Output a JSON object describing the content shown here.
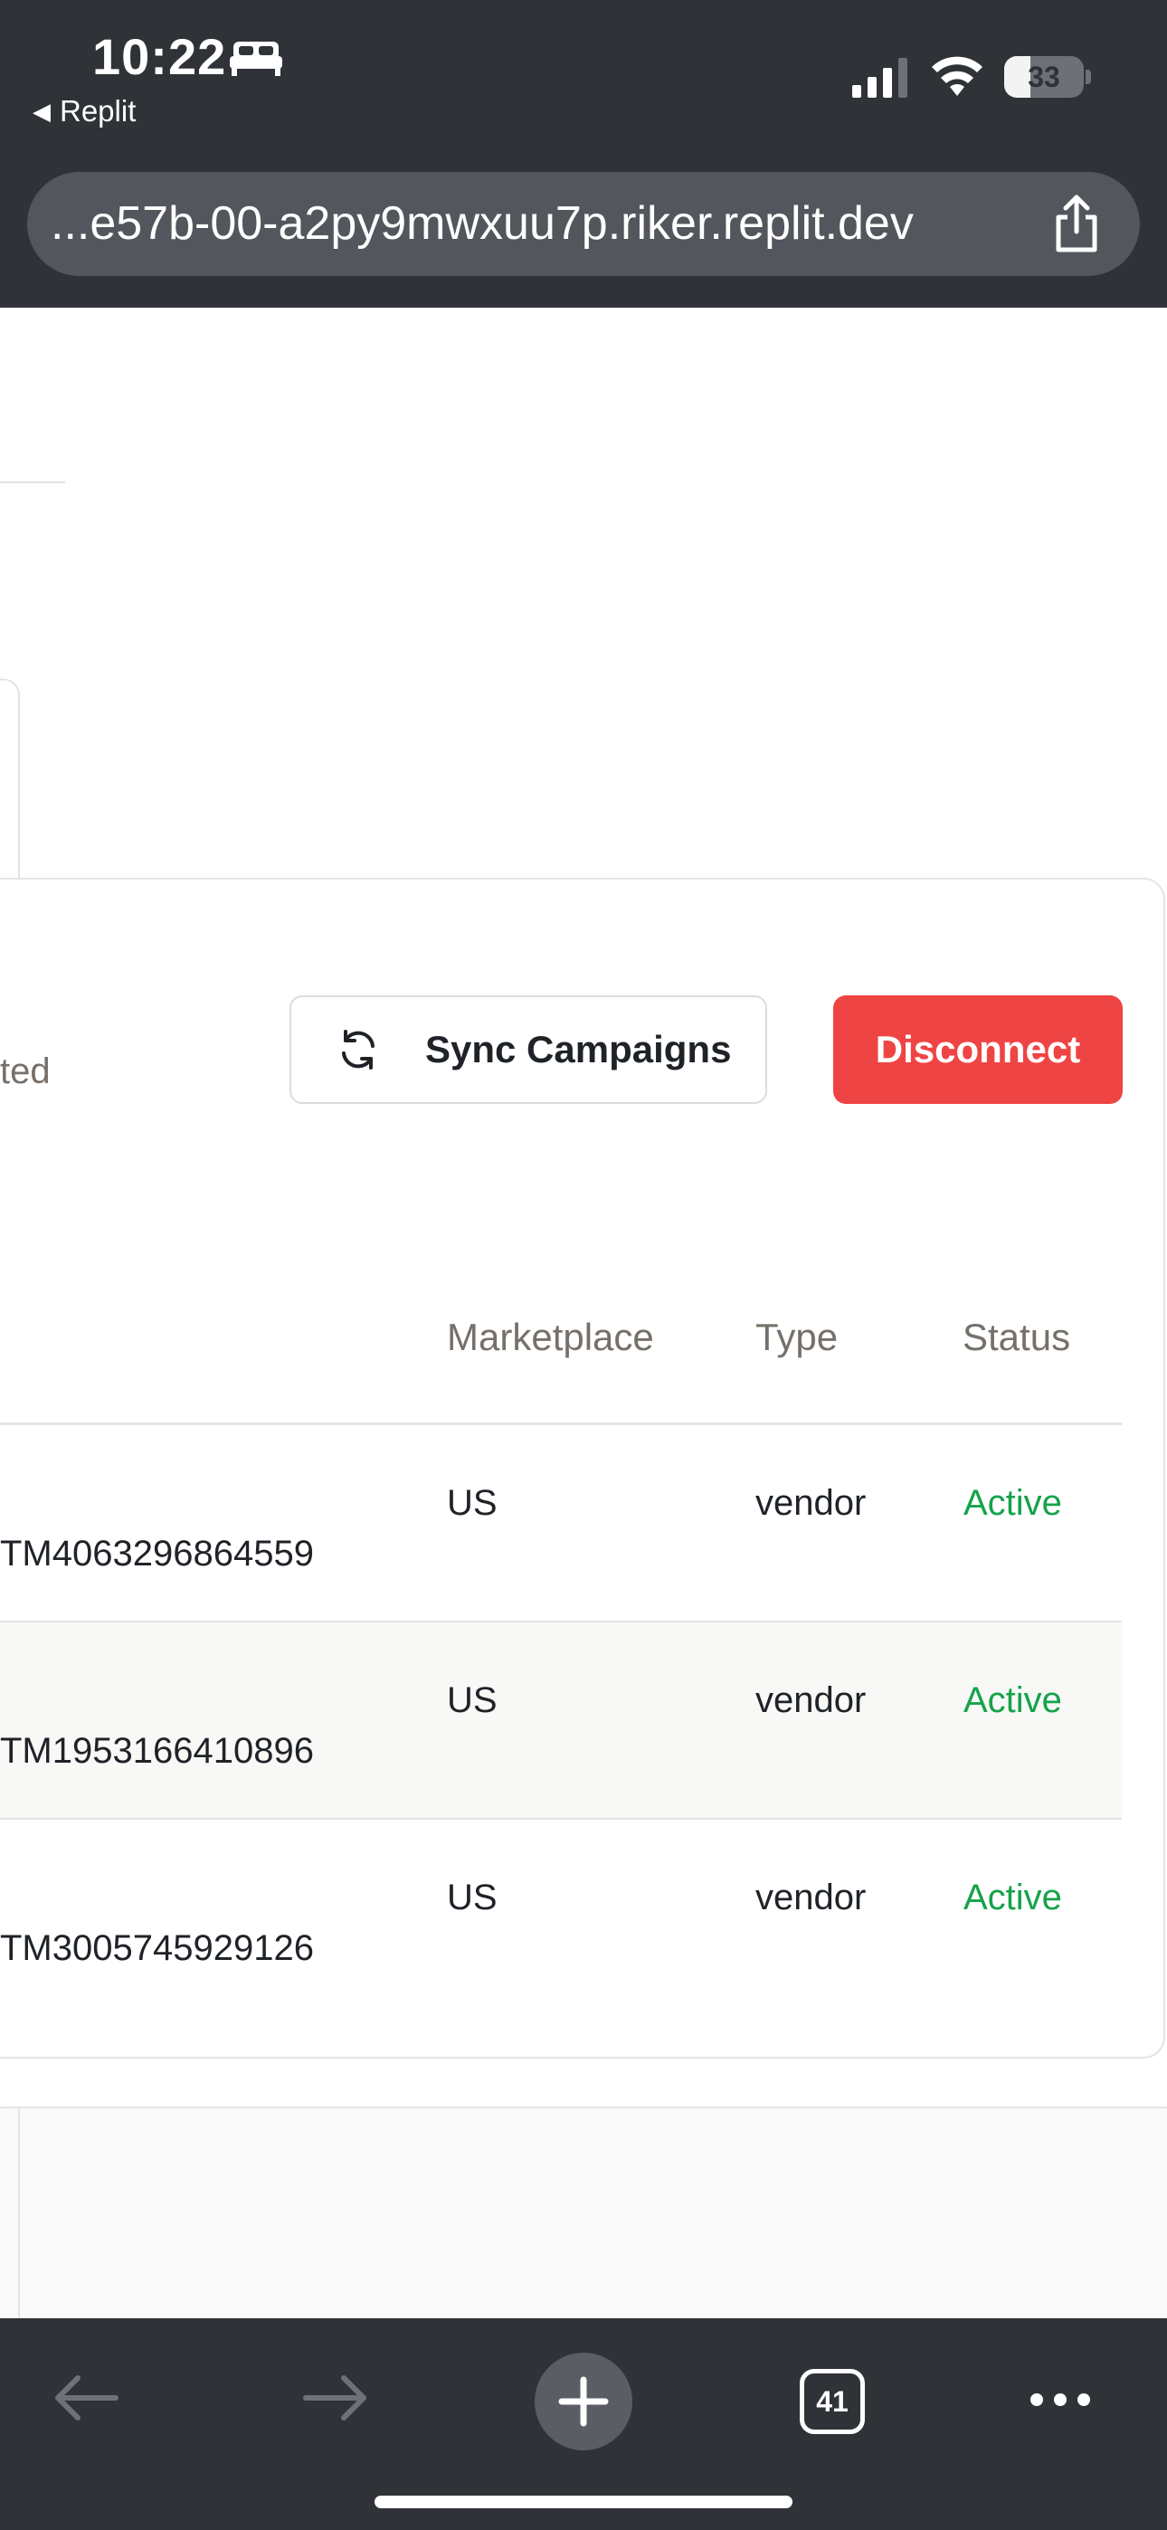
{
  "status_bar": {
    "time": "10:22",
    "back_app": "Replit",
    "battery_level": "33",
    "icons": [
      "bed-icon",
      "cellular-signal-icon",
      "wifi-icon",
      "battery-icon"
    ]
  },
  "browser": {
    "url": "...e57b-00-a2py9mwxuu7p.riker.replit.dev",
    "tab_count": "41",
    "toolbar_icons": [
      "back-arrow-icon",
      "forward-arrow-icon",
      "plus-icon",
      "tabs-icon",
      "more-icon"
    ]
  },
  "connection": {
    "status_text": "ted",
    "sync_button": "Sync Campaigns",
    "disconnect_button": "Disconnect"
  },
  "table": {
    "columns": [
      "Marketplace",
      "Type",
      "Status"
    ],
    "rows": [
      {
        "id": "TM4063296864559",
        "marketplace": "US",
        "type": "vendor",
        "status": "Active"
      },
      {
        "id": "TM1953166410896",
        "marketplace": "US",
        "type": "vendor",
        "status": "Active"
      },
      {
        "id": "TM3005745929126",
        "marketplace": "US",
        "type": "vendor",
        "status": "Active"
      }
    ]
  },
  "colors": {
    "chrome": "#2f3237",
    "danger": "#ef4444",
    "active": "#16a34a"
  }
}
